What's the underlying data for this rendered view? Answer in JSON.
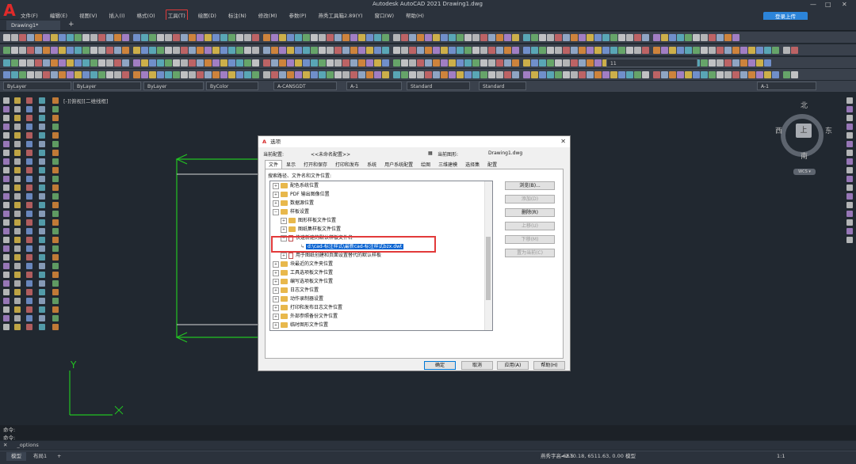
{
  "app": {
    "title": "Autodesk AutoCAD 2021    Drawing1.dwg",
    "logo_letter": "A",
    "login_label": "登录上传"
  },
  "menu": {
    "items": [
      "文件(F)",
      "编辑(E)",
      "视图(V)",
      "插入(I)",
      "格式(O)",
      "工具(T)",
      "绘图(D)",
      "标注(N)",
      "修改(M)",
      "参数(P)",
      "燕秀工具箱2.89(Y)",
      "窗口(W)",
      "帮助(H)"
    ],
    "active": "工具(T)"
  },
  "tabs": {
    "doc_tab": "Drawing1*",
    "add": "+"
  },
  "propbar": {
    "layer": "ByLayer",
    "linetype": "ByLayer",
    "lineweight": "ByLayer",
    "color": "ByColor",
    "text_style": "A-CANSGDT",
    "dim_style": "A-1",
    "table_style": "Standard",
    "mleader_style": "Standard",
    "layer_name": "A-1",
    "layer_count": "11"
  },
  "viewport": {
    "label": "[-][俯视][二维线框]",
    "compass": {
      "north": "北",
      "south": "南",
      "east": "东",
      "west": "西",
      "center": "上"
    },
    "wcs": "WCS ▾",
    "axis_y": "Y"
  },
  "dialog": {
    "title": "选项",
    "current_profile_label": "当前配置:",
    "current_profile": "<<未命名配置>>",
    "current_drawing_label": "当前图形:",
    "current_drawing": "Drawing1.dwg",
    "tabs": [
      "文件",
      "显示",
      "打开和保存",
      "打印和发布",
      "系统",
      "用户系统配置",
      "绘图",
      "三维建模",
      "选择集",
      "配置"
    ],
    "active_tab": "文件",
    "section_label": "搜索路径、文件名和文件位置:",
    "tree": [
      "配色系统位置",
      "PDF 输出图像位置",
      "数据源位置",
      "样板设置",
      "图形样板文件位置",
      "图纸集样板文件位置",
      "快速新建的默认样板文件名",
      "d:\\cad-标注样式\\最新cad-标注样式bzx.dwt",
      "用于图纸创建和页面设置替代的默认样板",
      "块最近的文件夹位置",
      "工具选项板文件位置",
      "编写选项板文件位置",
      "日志文件位置",
      "动作录制器设置",
      "打印和发布日志文件位置",
      "外部参照备份文件位置",
      "临时图形文件位置"
    ],
    "side_buttons": [
      "浏览(B)...",
      "添加(D)",
      "删除(R)",
      "上移(U)",
      "下移(M)",
      "置为当前(C)"
    ],
    "bottom_buttons": [
      "确定",
      "取消",
      "应用(A)",
      "帮助(H)"
    ]
  },
  "command": {
    "history_1": "命令:",
    "history_2": "命令:",
    "input": "_options"
  },
  "status": {
    "model_tab": "模型",
    "layout_tab": "布局1",
    "add": "+",
    "dim_style": "燕秀字高=2.5",
    "coordinates": "-6670.18, 6511.63, 0.00",
    "mode": "模型",
    "scale": "1:1"
  }
}
